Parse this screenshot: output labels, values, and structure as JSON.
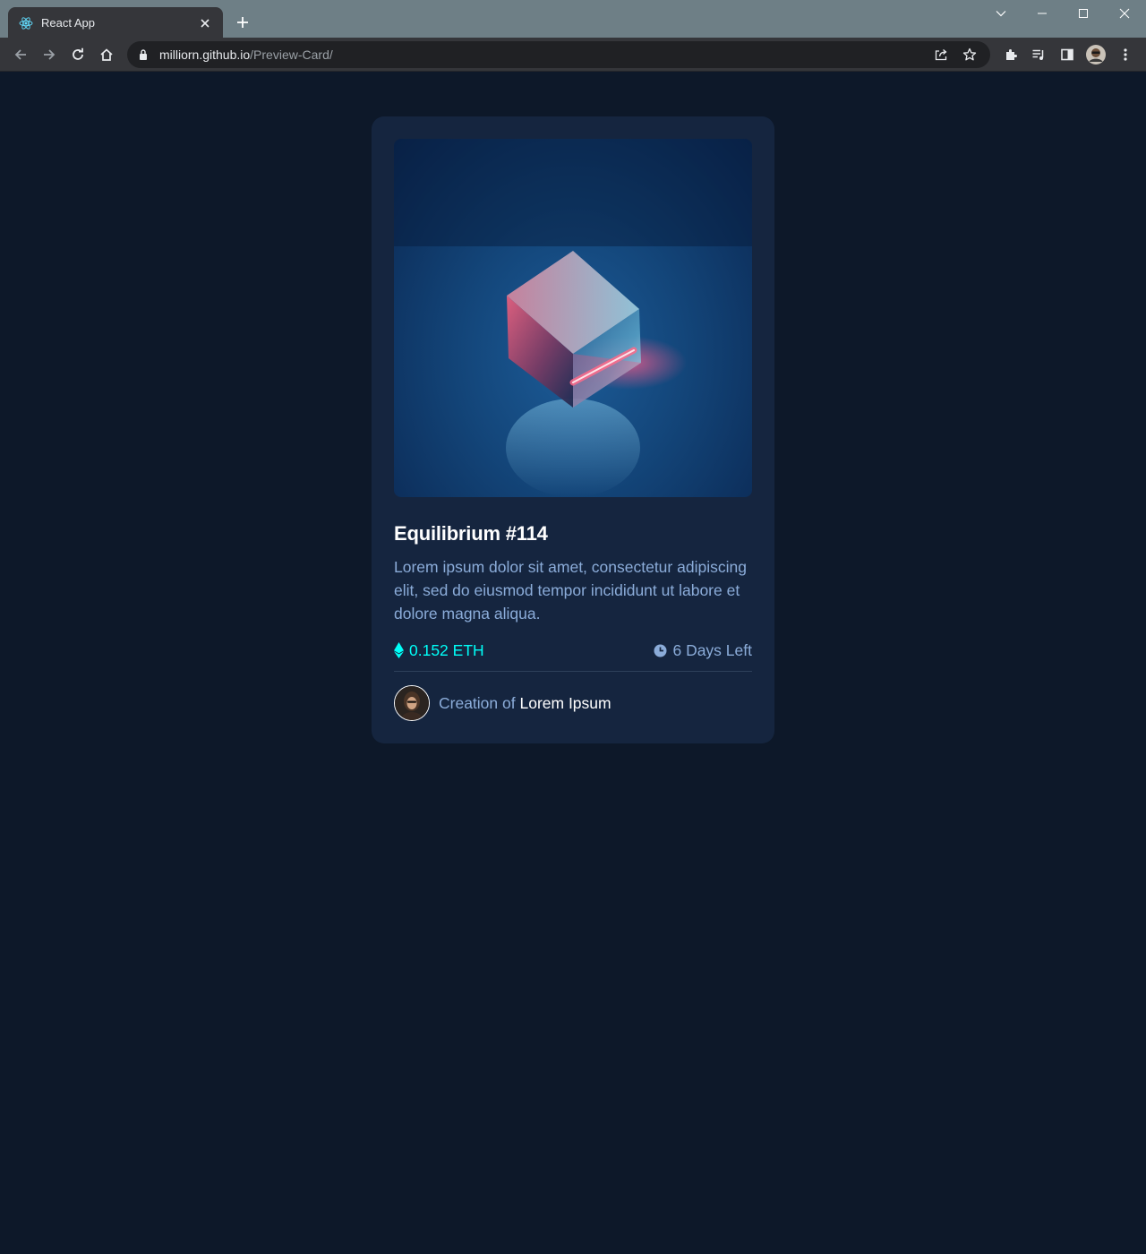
{
  "browser": {
    "tab_title": "React App",
    "url_host": "milliorn.github.io",
    "url_path": "/Preview-Card/"
  },
  "card": {
    "image_alt": "Equilibrium",
    "title": "Equilibrium #114",
    "description": "Lorem ipsum dolor sit amet, consectetur adipiscing elit, sed do eiusmod tempor incididunt ut labore et dolore magna aliqua.",
    "price": "0.152 ETH",
    "time_left": "6 Days Left",
    "creation_prefix": "Creation of",
    "creator_name": "Lorem Ipsum"
  },
  "colors": {
    "page_bg": "#0d1829",
    "card_bg": "#15253f",
    "cyan": "#00fff8",
    "soft_blue": "#8bacd9",
    "white": "#ffffff"
  },
  "icons": {
    "favicon": "react-logo-icon",
    "price": "ethereum-icon",
    "time": "clock-icon"
  }
}
